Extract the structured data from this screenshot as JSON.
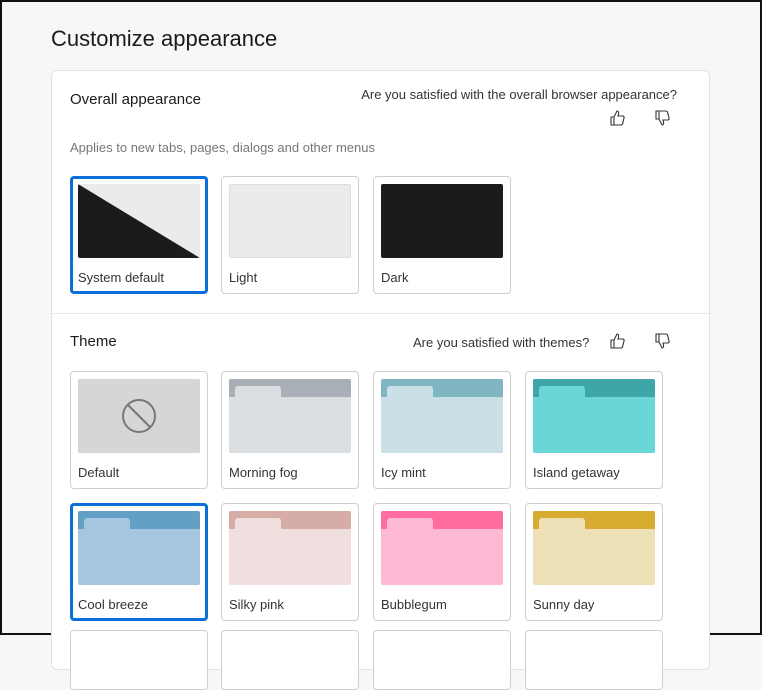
{
  "page_title": "Customize appearance",
  "overall": {
    "heading": "Overall appearance",
    "question": "Are you satisfied with the overall browser appearance?",
    "subtitle": "Applies to new tabs, pages, dialogs and other menus",
    "options": [
      {
        "label": "System default",
        "selected": true
      },
      {
        "label": "Light",
        "selected": false
      },
      {
        "label": "Dark",
        "selected": false
      }
    ]
  },
  "theme": {
    "heading": "Theme",
    "question": "Are you satisfied with themes?",
    "options": [
      {
        "label": "Default",
        "selected": false
      },
      {
        "label": "Morning fog",
        "bar": "#a8afb6",
        "body": "#dadee1",
        "selected": false
      },
      {
        "label": "Icy mint",
        "bar": "#80b5c2",
        "body": "#c9e0e6",
        "selected": false
      },
      {
        "label": "Island getaway",
        "bar": "#3ea6a8",
        "body": "#6bd6d8",
        "selected": false
      },
      {
        "label": "Cool breeze",
        "bar": "#64a0c6",
        "body": "#a6c6df",
        "selected": true
      },
      {
        "label": "Silky pink",
        "bar": "#d6aca6",
        "body": "#f1dfe0",
        "selected": false
      },
      {
        "label": "Bubblegum",
        "bar": "#ff6da0",
        "body": "#fdb8d3",
        "selected": false
      },
      {
        "label": "Sunny day",
        "bar": "#d8ab31",
        "body": "#eee0b6",
        "selected": false
      }
    ]
  },
  "colors": {
    "accent": "#0a6fd8"
  }
}
